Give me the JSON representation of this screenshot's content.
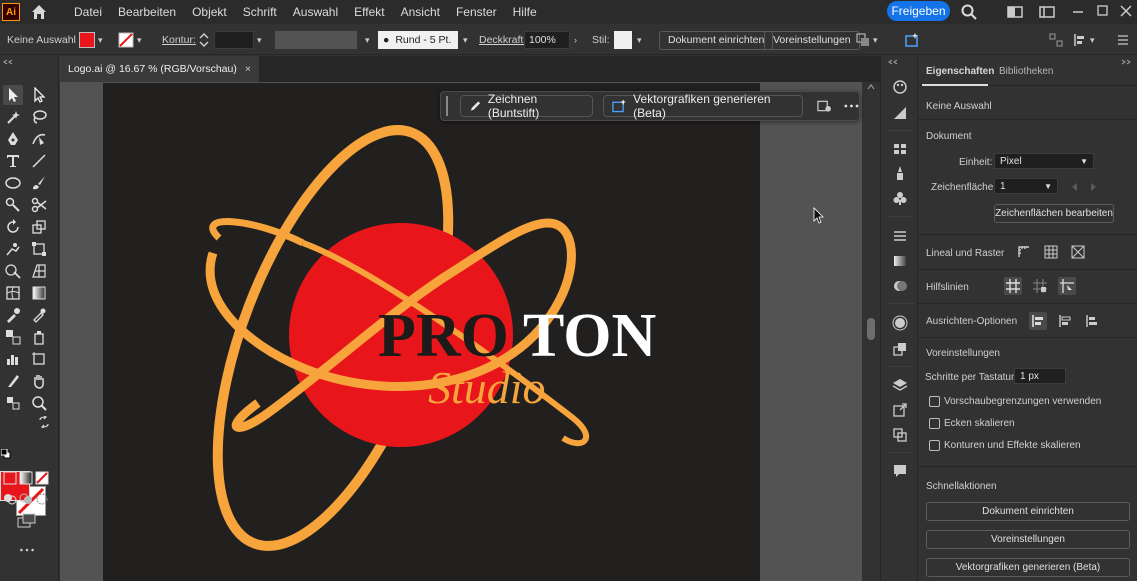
{
  "app": {
    "logo_text": "Ai"
  },
  "menu": {
    "items": [
      "Datei",
      "Bearbeiten",
      "Objekt",
      "Schrift",
      "Auswahl",
      "Effekt",
      "Ansicht",
      "Fenster",
      "Hilfe"
    ],
    "share_label": "Freigeben"
  },
  "control_bar": {
    "selection_status": "Keine Auswahl",
    "fill_color": "#e8161a",
    "stroke_label": "Kontur:",
    "stroke_value": "",
    "brush_label": "Rund - 5 Pt.",
    "opacity_label": "Deckkraft:",
    "opacity_value": "100%",
    "style_label": "Stil:",
    "doc_setup_label": "Dokument einrichten",
    "preferences_label": "Voreinstellungen"
  },
  "document_tab": {
    "title": "Logo.ai @ 16.67 % (RGB/Vorschau)",
    "close": "×"
  },
  "contextual_taskbar": {
    "draw_label": "Zeichnen (Buntstift)",
    "generate_label": "Vektorgrafiken generieren (Beta)"
  },
  "artwork": {
    "brand_pro": "PRO",
    "brand_ton": "TON",
    "brand_studio": "Studio",
    "colors": {
      "orange": "#f6a43b",
      "red": "#e8161a",
      "dark": "#1d1a1a",
      "white": "#ffffff",
      "artboard_bg": "#221f1f"
    }
  },
  "panel": {
    "tab_properties": "Eigenschaften",
    "tab_libraries": "Bibliotheken",
    "no_selection": "Keine Auswahl",
    "document_heading": "Dokument",
    "unit_label": "Einheit:",
    "unit_value": "Pixel",
    "artboard_label": "Zeichenfläche:",
    "artboard_value": "1",
    "edit_artboards_label": "Zeichenflächen bearbeiten",
    "rulers_grid_label": "Lineal und Raster",
    "guides_label": "Hilfslinien",
    "align_options_label": "Ausrichten-Optionen",
    "preferences_heading": "Voreinstellungen",
    "keyboard_increment_label": "Schritte per Tastatur:",
    "keyboard_increment_value": "1 px",
    "checkbox_preview_bounds": "Vorschaubegrenzungen verwenden",
    "checkbox_scale_corners": "Ecken skalieren",
    "checkbox_scale_strokes": "Konturen und Effekte skalieren",
    "quick_actions_heading": "Schnellaktionen",
    "qa_doc_setup": "Dokument einrichten",
    "qa_preferences": "Voreinstellungen",
    "qa_generate_vectors": "Vektorgrafiken generieren (Beta)"
  }
}
